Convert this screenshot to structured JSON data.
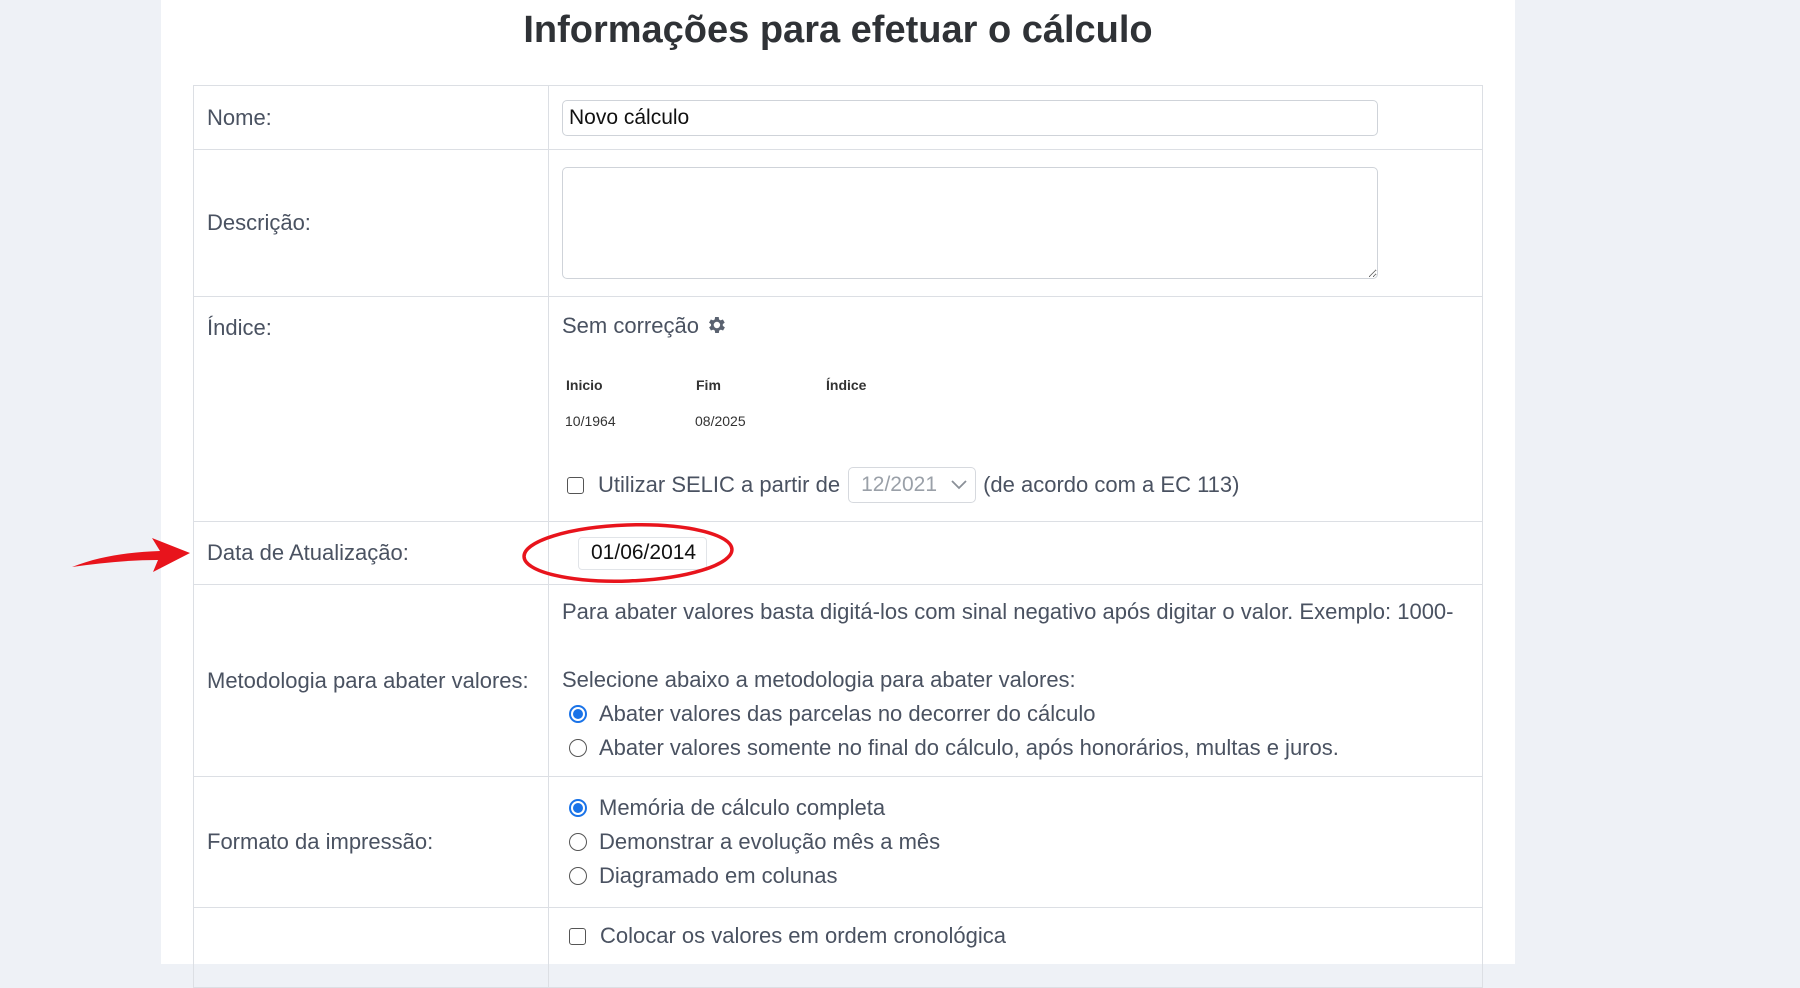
{
  "page": {
    "title": "Informações para efetuar o cálculo"
  },
  "form": {
    "nome": {
      "label": "Nome:",
      "value": "Novo cálculo"
    },
    "descricao": {
      "label": "Descrição:",
      "value": ""
    },
    "indice": {
      "label": "Índice:",
      "name": "Sem correção",
      "settings_icon": "gear-icon",
      "table": {
        "headers": [
          "Inicio",
          "Fim",
          "Índice"
        ],
        "rows": [
          [
            "10/1964",
            "08/2025",
            ""
          ]
        ]
      },
      "selic": {
        "checked": false,
        "label": "Utilizar SELIC a partir de",
        "select_value": "12/2021",
        "suffix": "(de acordo com a EC 113)"
      }
    },
    "data_atualizacao": {
      "label": "Data de Atualização:",
      "value": "01/06/2014"
    },
    "metodologia": {
      "label": "Metodologia para abater valores:",
      "hint": "Para abater valores basta digitá-los com sinal negativo após digitar o valor. Exemplo: 1000-",
      "prompt": "Selecione abaixo a metodologia para abater valores:",
      "options": [
        {
          "label": "Abater valores das parcelas no decorrer do cálculo",
          "selected": true
        },
        {
          "label": "Abater valores somente no final do cálculo, após honorários, multas e juros.",
          "selected": false
        }
      ]
    },
    "formato": {
      "label": "Formato da impressão:",
      "options": [
        {
          "label": "Memória de cálculo completa",
          "selected": true
        },
        {
          "label": "Demonstrar a evolução mês a mês",
          "selected": false
        },
        {
          "label": "Diagramado em colunas",
          "selected": false
        }
      ]
    },
    "ordem": {
      "label": "Colocar os valores em ordem cronológica",
      "checked": false
    }
  },
  "colors": {
    "accent": "#1a73e8",
    "annotation": "#e8141c",
    "background": "#eef1f6"
  }
}
